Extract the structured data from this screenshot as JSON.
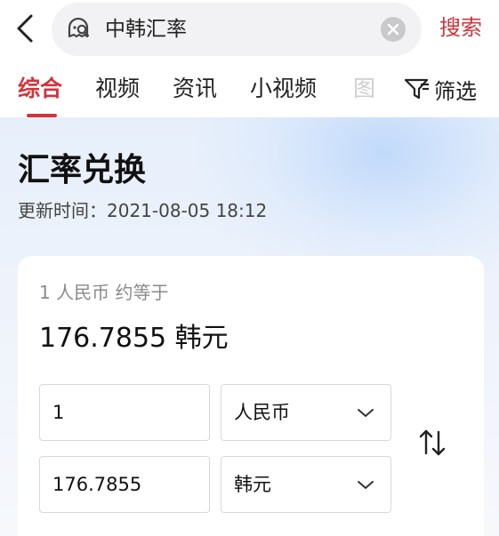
{
  "search": {
    "query": "中韩汇率",
    "submit_label": "搜索"
  },
  "tabs": [
    {
      "label": "综合",
      "active": true
    },
    {
      "label": "视频",
      "active": false
    },
    {
      "label": "资讯",
      "active": false
    },
    {
      "label": "小视频",
      "active": false
    },
    {
      "label": "图",
      "active": false
    }
  ],
  "filter": {
    "label": "筛选"
  },
  "converter": {
    "title": "汇率兑换",
    "updated": "更新时间：2021-08-05 18:12",
    "rate_caption": "1 人民币 约等于",
    "rate_result": "176.7855 韩元",
    "from": {
      "amount": "1",
      "currency": "人民币"
    },
    "to": {
      "amount": "176.7855",
      "currency": "韩元"
    }
  },
  "colors": {
    "accent": "#d0343c",
    "page_gradient_top": "#e7effb"
  },
  "icons": [
    "back-arrow-icon",
    "search-icon",
    "clear-icon",
    "filter-icon",
    "chevron-down-icon",
    "swap-icon"
  ]
}
